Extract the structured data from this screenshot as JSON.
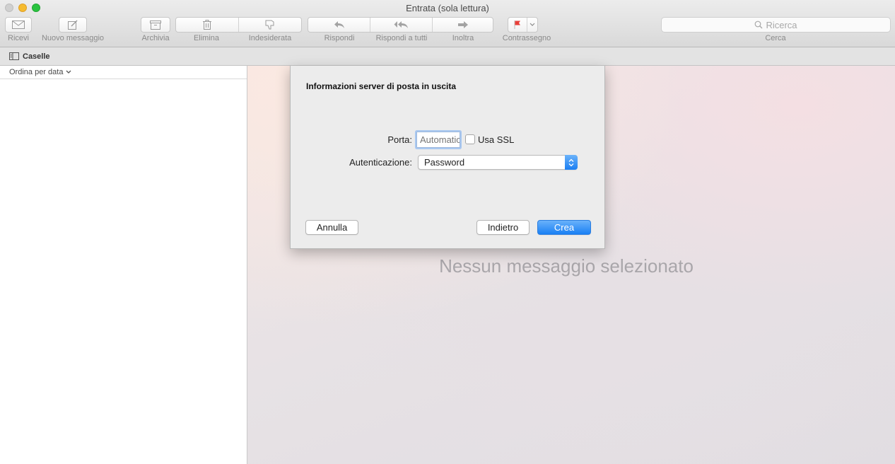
{
  "window": {
    "title": "Entrata (sola lettura)"
  },
  "toolbar": {
    "receive_label": "Ricevi",
    "new_message_label": "Nuovo messaggio",
    "archive_label": "Archivia",
    "delete_label": "Elimina",
    "junk_label": "Indesiderata",
    "reply_label": "Rispondi",
    "reply_all_label": "Rispondi a tutti",
    "forward_label": "Inoltra",
    "flag_label": "Contrassegno",
    "search_placeholder": "Ricerca",
    "search_label": "Cerca",
    "flag_color": "#e8403a"
  },
  "favorites": {
    "mailboxes_label": "Caselle"
  },
  "message_list": {
    "sort_label": "Ordina per data"
  },
  "viewer": {
    "empty_text": "Nessun messaggio selezionato"
  },
  "dialog": {
    "title": "Informazioni server di posta in uscita",
    "port_label": "Porta:",
    "port_placeholder": "Automatico",
    "port_value": "",
    "ssl_label": "Usa SSL",
    "ssl_checked": false,
    "auth_label": "Autenticazione:",
    "auth_value": "Password",
    "cancel_label": "Annulla",
    "back_label": "Indietro",
    "create_label": "Crea",
    "accent_color": "#1a80f4"
  }
}
